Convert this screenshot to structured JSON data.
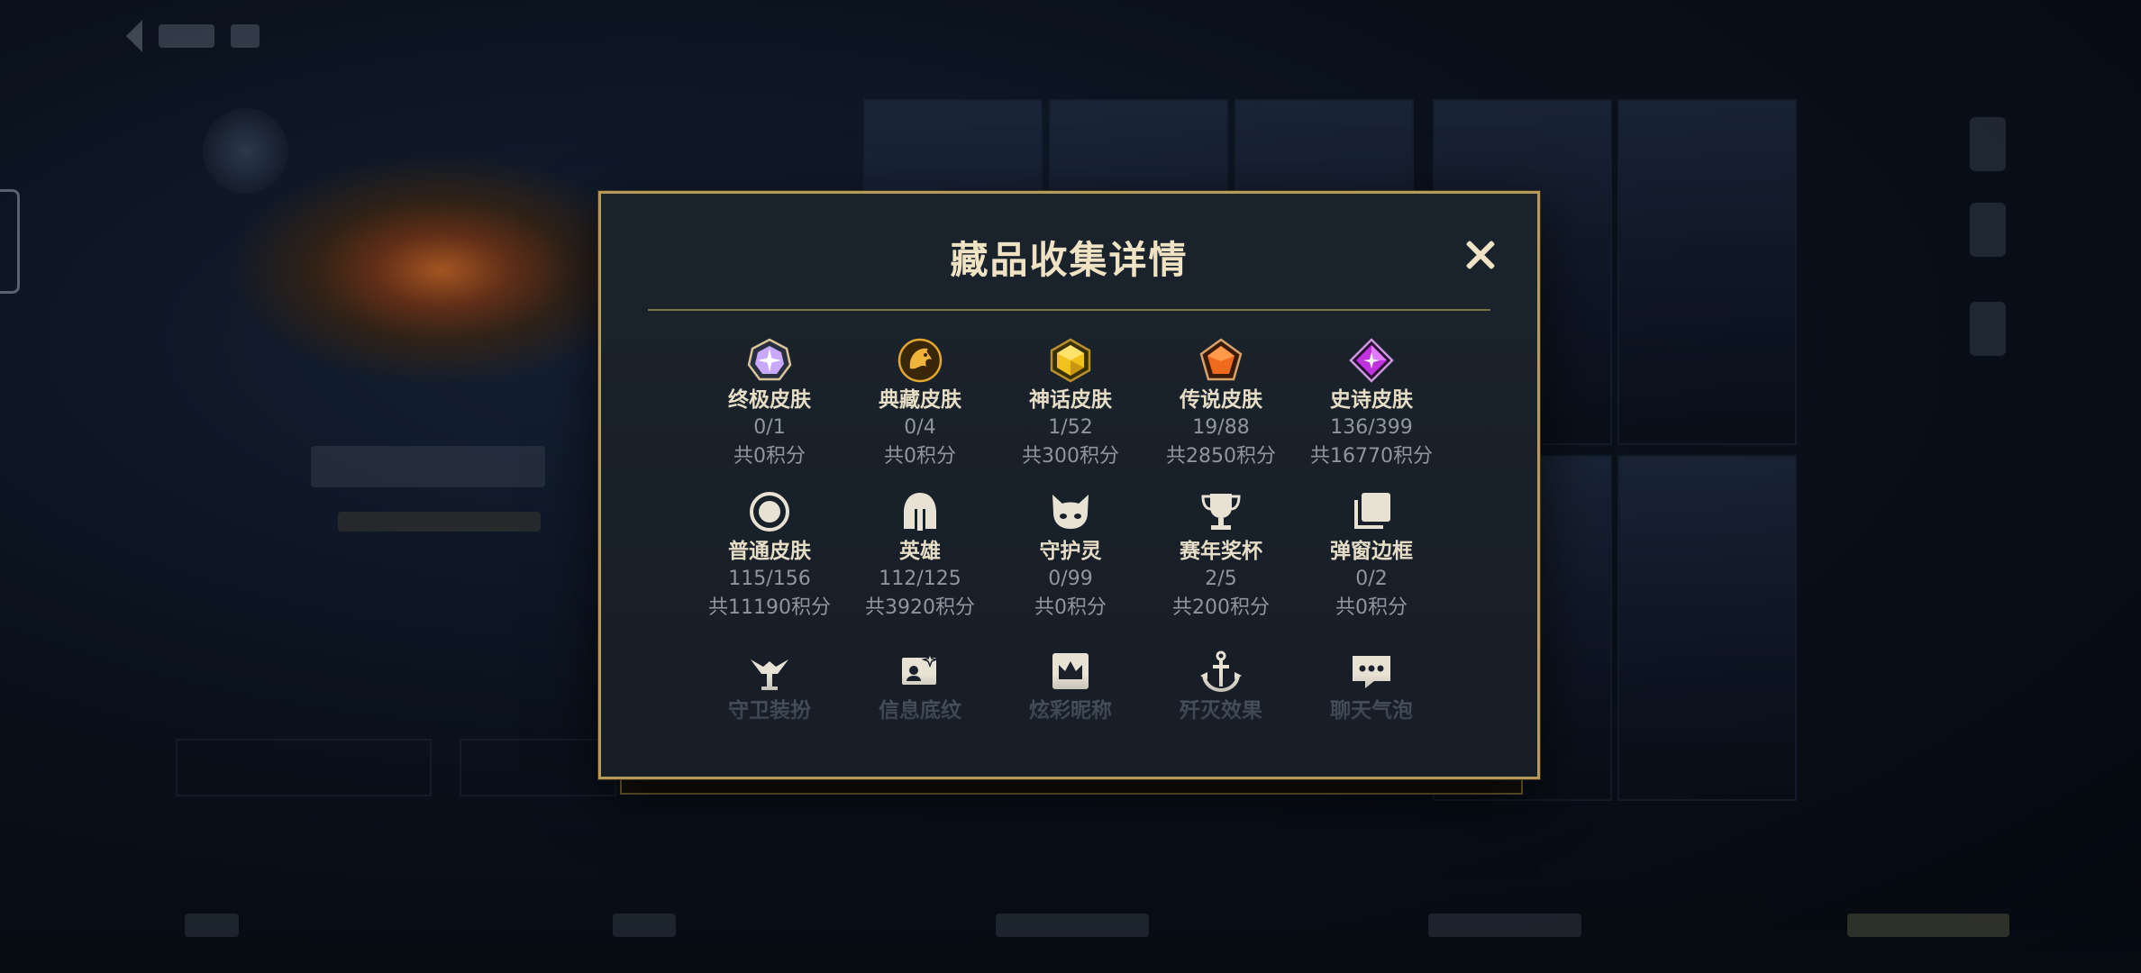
{
  "modal": {
    "title": "藏品收集详情",
    "rows": [
      [
        {
          "label": "终极皮肤",
          "count": "0/1",
          "points": "共0积分",
          "icon": "ultimate-skin-gem-icon",
          "color": "#b98cff"
        },
        {
          "label": "典藏皮肤",
          "count": "0/4",
          "points": "共0积分",
          "icon": "collection-skin-dragon-icon",
          "color": "#e0a630"
        },
        {
          "label": "神话皮肤",
          "count": "1/52",
          "points": "共300积分",
          "icon": "mythic-skin-gem-icon",
          "color": "#f2c21c"
        },
        {
          "label": "传说皮肤",
          "count": "19/88",
          "points": "共2850积分",
          "icon": "legendary-skin-gem-icon",
          "color": "#f06a1e"
        },
        {
          "label": "史诗皮肤",
          "count": "136/399",
          "points": "共16770积分",
          "icon": "epic-skin-gem-icon",
          "color": "#c032e0"
        }
      ],
      [
        {
          "label": "普通皮肤",
          "count": "115/156",
          "points": "共11190积分",
          "icon": "normal-skin-ring-icon"
        },
        {
          "label": "英雄",
          "count": "112/125",
          "points": "共3920积分",
          "icon": "helmet-icon"
        },
        {
          "label": "守护灵",
          "count": "0/99",
          "points": "共0积分",
          "icon": "guardian-spirit-icon"
        },
        {
          "label": "赛年奖杯",
          "count": "2/5",
          "points": "共200积分",
          "icon": "trophy-icon"
        },
        {
          "label": "弹窗边框",
          "count": "0/2",
          "points": "共0积分",
          "icon": "popup-frame-icon"
        }
      ],
      [
        {
          "label": "守卫装扮",
          "icon": "ward-skin-icon"
        },
        {
          "label": "信息底纹",
          "icon": "profile-card-icon"
        },
        {
          "label": "炫彩昵称",
          "icon": "crown-nameplate-icon"
        },
        {
          "label": "歼灭效果",
          "icon": "anchor-icon"
        },
        {
          "label": "聊天气泡",
          "icon": "chat-bubble-icon"
        }
      ]
    ]
  },
  "colors": {
    "modal_border": "#b59a5a",
    "title": "#efe3c4",
    "label": "#e6ddc6",
    "muted": "#8f96a0"
  }
}
